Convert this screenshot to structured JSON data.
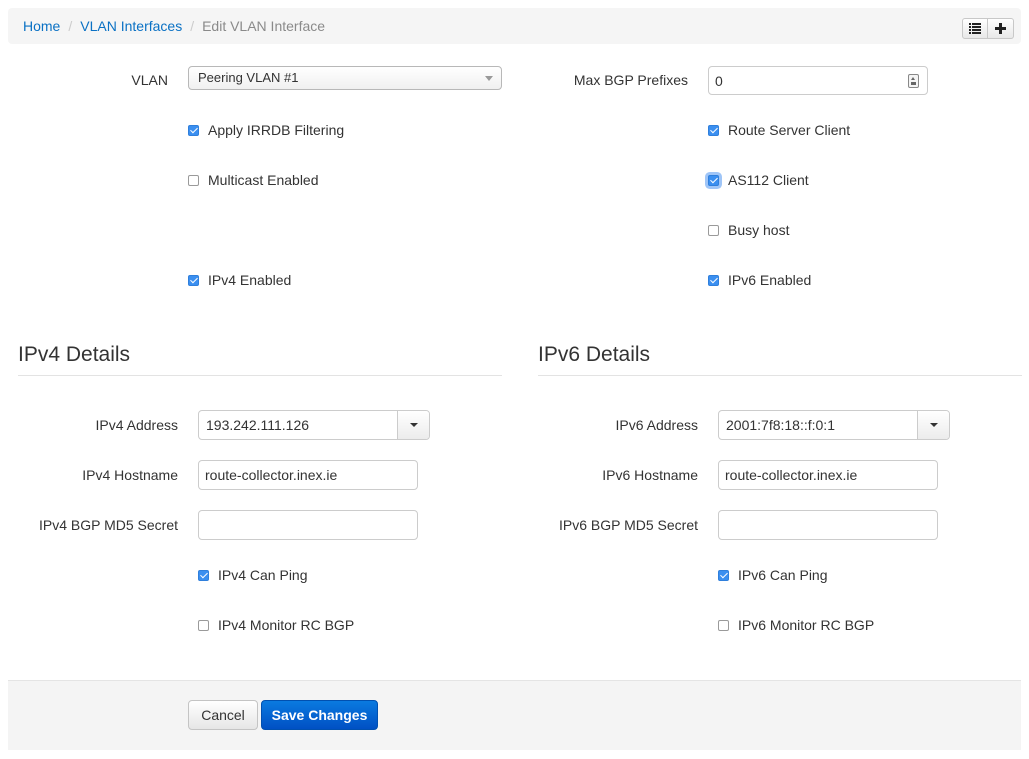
{
  "breadcrumb": {
    "items": [
      "Home",
      "VLAN Interfaces"
    ],
    "active": "Edit VLAN Interface",
    "separator": "/"
  },
  "toolbar": {
    "list_icon": "list-icon",
    "add_icon": "plus-icon"
  },
  "general": {
    "vlan_label": "VLAN",
    "vlan_value": "Peering VLAN #1",
    "max_prefixes_label": "Max BGP Prefixes",
    "max_prefixes_value": "0",
    "checkboxes": {
      "irrdb": {
        "label": "Apply IRRDB Filtering",
        "checked": true
      },
      "multicast": {
        "label": "Multicast Enabled",
        "checked": false
      },
      "ipv4_enabled": {
        "label": "IPv4 Enabled",
        "checked": true
      },
      "rs_client": {
        "label": "Route Server Client",
        "checked": true
      },
      "as112": {
        "label": "AS112 Client",
        "checked": true
      },
      "busy_host": {
        "label": "Busy host",
        "checked": false
      },
      "ipv6_enabled": {
        "label": "IPv6 Enabled",
        "checked": true
      }
    }
  },
  "ipv4": {
    "title": "IPv4 Details",
    "address_label": "IPv4 Address",
    "address_value": "193.242.111.126",
    "hostname_label": "IPv4 Hostname",
    "hostname_value": "route-collector.inex.ie",
    "md5_label": "IPv4 BGP MD5 Secret",
    "md5_value": "",
    "can_ping": {
      "label": "IPv4 Can Ping",
      "checked": true
    },
    "monitor_rc": {
      "label": "IPv4 Monitor RC BGP",
      "checked": false
    }
  },
  "ipv6": {
    "title": "IPv6 Details",
    "address_label": "IPv6 Address",
    "address_value": "2001:7f8:18::f:0:1",
    "hostname_label": "IPv6 Hostname",
    "hostname_value": "route-collector.inex.ie",
    "md5_label": "IPv6 BGP MD5 Secret",
    "md5_value": "",
    "can_ping": {
      "label": "IPv6 Can Ping",
      "checked": true
    },
    "monitor_rc": {
      "label": "IPv6 Monitor RC BGP",
      "checked": false
    }
  },
  "actions": {
    "cancel_label": "Cancel",
    "save_label": "Save Changes"
  }
}
